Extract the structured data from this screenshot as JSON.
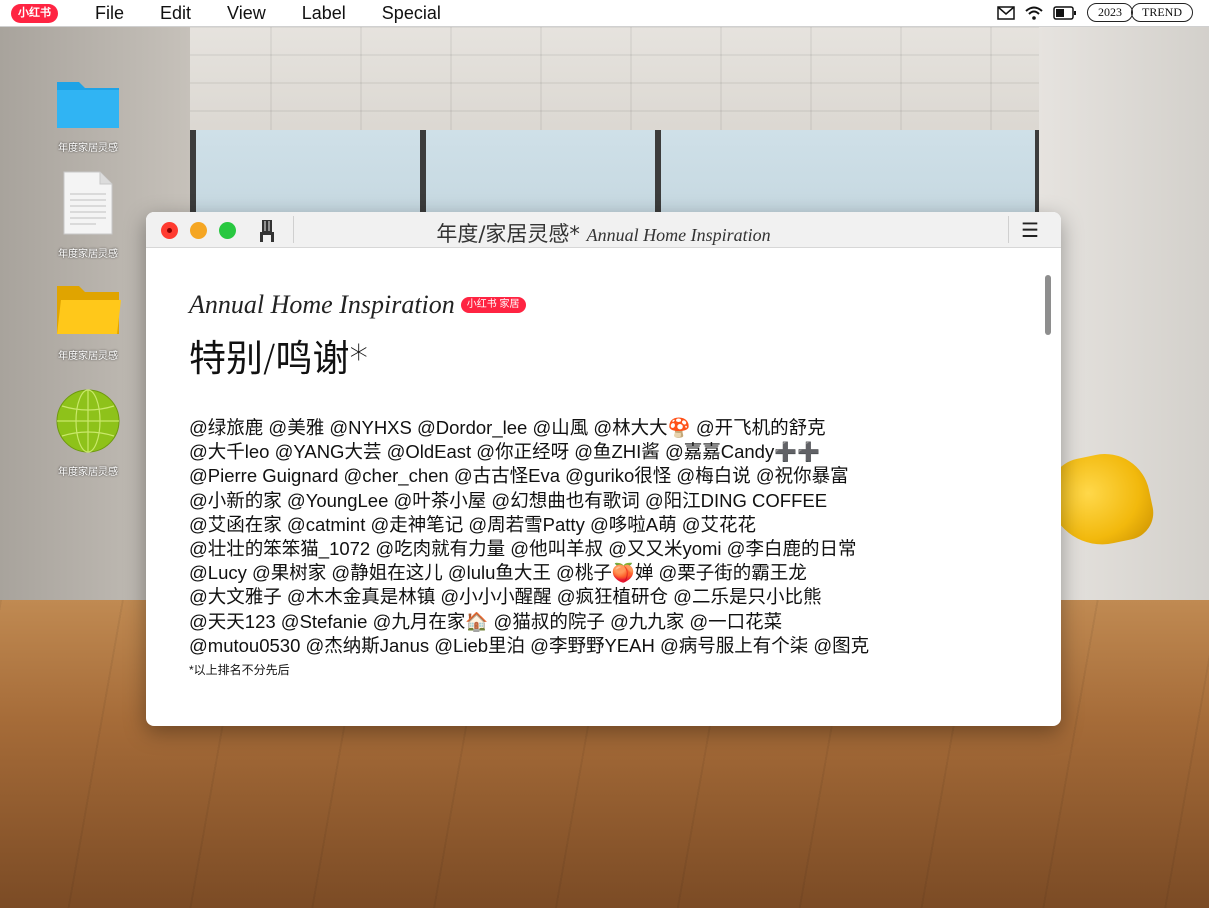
{
  "menubar": {
    "logo": "小红书",
    "items": [
      "File",
      "Edit",
      "View",
      "Label",
      "Special"
    ],
    "badge_year": "2023",
    "badge_trend": "TREND"
  },
  "desktop": {
    "icons": [
      {
        "label": "年度家居灵感",
        "icon": "blue-folder-icon"
      },
      {
        "label": "年度家居灵感",
        "icon": "document-icon"
      },
      {
        "label": "年度家居灵感",
        "icon": "yellow-folder-icon"
      },
      {
        "label": "年度家居灵感",
        "icon": "globe-icon"
      }
    ]
  },
  "window": {
    "title_cn": "年度/家居灵感*",
    "title_en": "Annual Home Inspiration",
    "subtitle": "Annual Home Inspiration",
    "tag": "小红书 家居",
    "heading": "特别/鸣谢*",
    "credits": [
      "@绿旅鹿 @美雅 @NYHXS @Dordor_lee @山風 @林大大🍄 @开飞机的舒克",
      "@大千leo @YANG大芸 @OldEast @你正经呀 @鱼ZHI酱 @嘉嘉Candy➕➕",
      "@Pierre Guignard @cher_chen @古古怪Eva @guriko很怪 @梅白说 @祝你暴富",
      "@小新的家 @YoungLee @叶茶小屋 @幻想曲也有歌词 @阳江DING COFFEE",
      "@艾函在家 @catmint @走神笔记 @周若雪Patty @哆啦A萌 @艾花花",
      "@壮壮的笨笨猫_1072 @吃肉就有力量 @他叫羊叔 @又又米yomi @李白鹿的日常",
      "@Lucy @果树家 @静姐在这儿 @lulu鱼大王 @桃子🍑婵 @栗子街的霸王龙",
      "@大文雅子 @木木金真是林镇 @小小小醒醒 @疯狂植研仓 @二乐是只小比熊",
      "@天天123 @Stefanie @九月在家🏠 @猫叔的院子 @九九家 @一口花菜",
      "@mutou0530 @杰纳斯Janus @Lieb里泊 @李野野YEAH @病号服上有个柒 @图克"
    ],
    "footnote": "*以上排名不分先后"
  },
  "colors": {
    "brand_red": "#ff2442",
    "close": "#ff3b30",
    "minimize": "#f5a623",
    "zoom": "#28c840"
  }
}
